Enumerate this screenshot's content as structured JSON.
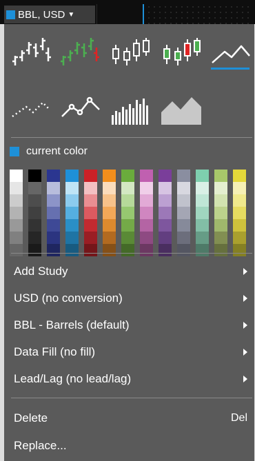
{
  "topbar": {
    "symbol_label": "BBL, USD",
    "symbol_color": "#1e90d8"
  },
  "chart_types": [
    {
      "name": "ohlc-bars-icon",
      "selected": false
    },
    {
      "name": "colored-ohlc-bars-icon",
      "selected": false
    },
    {
      "name": "candlestick-icon",
      "selected": false
    },
    {
      "name": "colored-candlestick-icon",
      "selected": false
    },
    {
      "name": "line-icon",
      "selected": true
    },
    {
      "name": "dotted-line-icon",
      "selected": false
    },
    {
      "name": "line-with-markers-icon",
      "selected": false
    },
    {
      "name": "histogram-icon",
      "selected": false
    },
    {
      "name": "mountain-area-icon",
      "selected": false
    }
  ],
  "current_color": {
    "label": "current color",
    "color": "#1e90d8"
  },
  "palette": [
    [
      "#ffffff",
      "#e6e6e6",
      "#cccccc",
      "#b3b3b3",
      "#999999",
      "#808080",
      "#666666"
    ],
    [
      "#000000",
      "#666666",
      "#4d4d4d",
      "#404040",
      "#333333",
      "#262626",
      "#1a1a1a"
    ],
    [
      "#2b3690",
      "#b8bddc",
      "#8c94c8",
      "#6670b0",
      "#3e4996",
      "#2b3480",
      "#1f2660"
    ],
    [
      "#1e90d8",
      "#bfe4f6",
      "#8ccbee",
      "#55afe0",
      "#2a8fc6",
      "#1f74a4",
      "#185b80"
    ],
    [
      "#cc2127",
      "#f4c0c2",
      "#ea8e92",
      "#dc5a60",
      "#c22a30",
      "#9a1e24",
      "#74161a"
    ],
    [
      "#f28e1c",
      "#fbdcbb",
      "#f7c28a",
      "#f2a858",
      "#dd8a2e",
      "#b26a20",
      "#855018"
    ],
    [
      "#6aac3c",
      "#d3e8c3",
      "#b6d99a",
      "#96c870",
      "#74aa48",
      "#5a8a36",
      "#446a28"
    ],
    [
      "#c060b0",
      "#f0cfe9",
      "#e2aad6",
      "#d086c0",
      "#b464a4",
      "#8e4a82",
      "#6c3862"
    ],
    [
      "#7a3e9a",
      "#d7c4e3",
      "#bca0d2",
      "#9c78b8",
      "#7e569e",
      "#623e80",
      "#4a2e60"
    ],
    [
      "#8a8ea0",
      "#d8d8e0",
      "#c0c2cc",
      "#a4a6b4",
      "#868a9a",
      "#6c6e7c",
      "#545662"
    ],
    [
      "#7ecfae",
      "#d9f0e6",
      "#bfe6d6",
      "#a0d6bf",
      "#82bea6",
      "#669c86",
      "#4e7a68"
    ],
    [
      "#a8c86a",
      "#e4efcf",
      "#d2e3b0",
      "#bcd28c",
      "#a0b86c",
      "#828f52",
      "#66703e"
    ],
    [
      "#e4d83a",
      "#f6f0b4",
      "#f0e98c",
      "#e6dc60",
      "#cfc23c",
      "#aaa02e",
      "#858024"
    ]
  ],
  "menu_items": [
    {
      "label": "Add Study",
      "submenu": true
    },
    {
      "label": "USD (no conversion)",
      "submenu": true
    },
    {
      "label": "BBL - Barrels (default)",
      "submenu": true
    },
    {
      "label": "Data Fill (no fill)",
      "submenu": true
    },
    {
      "label": "Lead/Lag (no lead/lag)",
      "submenu": true
    }
  ],
  "delete_item": {
    "label": "Delete",
    "shortcut": "Del"
  },
  "replace_item": {
    "label": "Replace..."
  }
}
